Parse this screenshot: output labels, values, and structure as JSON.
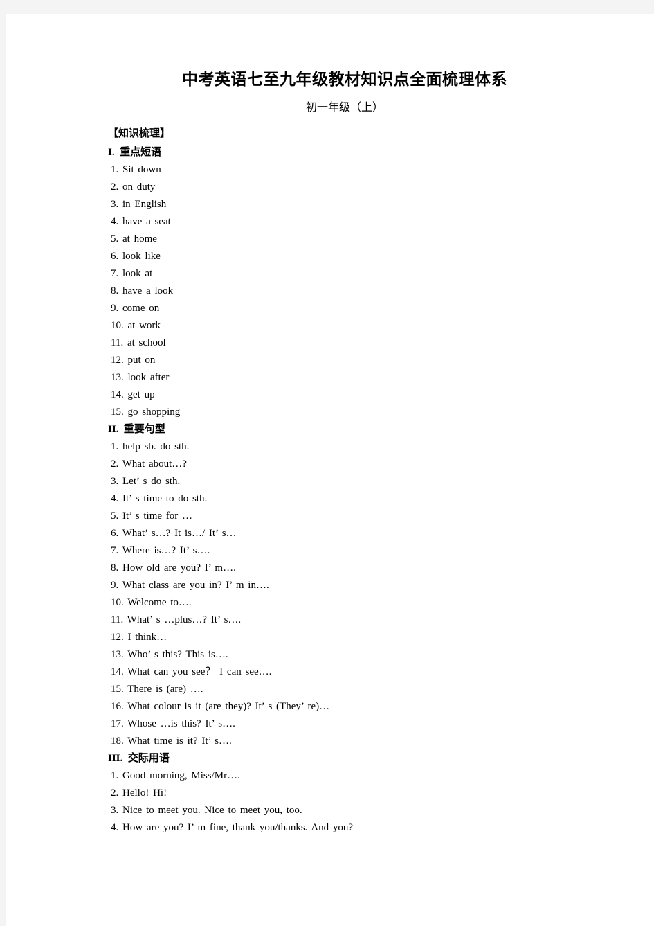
{
  "document": {
    "title": "中考英语七至九年级教材知识点全面梳理体系",
    "subtitle": "初一年级（上）",
    "bracket_heading": "【知识梳理】",
    "sections": [
      {
        "numeral": "I.",
        "heading": "重点短语",
        "heading_full": "I.  重点短语",
        "items": [
          "1. Sit down",
          "2. on duty",
          "3. in English",
          "4. have a seat",
          "5. at home",
          "6. look like",
          "7. look at",
          "8. have a look",
          "9. come on",
          "10. at work",
          "11. at school",
          "12. put on",
          "13. look after",
          "14. get up",
          "15. go shopping"
        ]
      },
      {
        "numeral": "II.",
        "heading": "重要句型",
        "heading_full": "II.  重要句型",
        "items": [
          "1. help sb. do sth.",
          "2. What about…?",
          "3. Let’ s do sth.",
          "4. It’ s time to do sth.",
          "5. It’ s time for …",
          "6. What’ s…? It is…/ It’ s…",
          "7. Where is…? It’ s….",
          "8. How old are you? I’ m….",
          "9. What class are you in? I’ m in….",
          "10. Welcome to….",
          "11. What’ s …plus…? It’ s….",
          "12. I think…",
          "13. Who’ s this? This is….",
          "14. What can you see？ I can see….",
          "15. There is (are) ….",
          "16. What colour is it (are they)? It’ s (They’ re)…",
          "17. Whose …is this? It’ s….",
          "18. What time is it? It’ s…."
        ]
      },
      {
        "numeral": "III.",
        "heading": "交际用语",
        "heading_full": "III.  交际用语",
        "items": [
          "1. Good morning, Miss/Mr….",
          "2. Hello! Hi!",
          "3. Nice to meet you. Nice to meet you, too.",
          "4. How are you? I’ m fine, thank you/thanks. And you?"
        ]
      }
    ]
  }
}
